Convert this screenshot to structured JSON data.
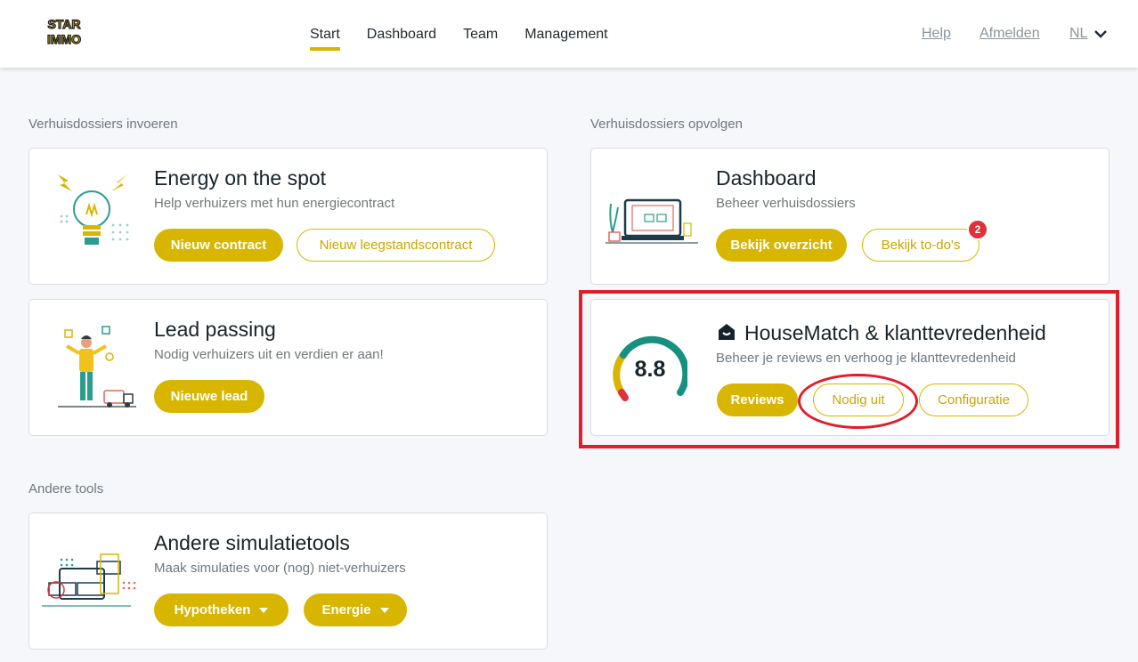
{
  "header": {
    "logo_text_top": "STAR",
    "logo_text_bottom": "IMMO",
    "nav": [
      {
        "label": "Start",
        "active": true
      },
      {
        "label": "Dashboard",
        "active": false
      },
      {
        "label": "Team",
        "active": false
      },
      {
        "label": "Management",
        "active": false
      }
    ],
    "help_label": "Help",
    "logout_label": "Afmelden",
    "language": "NL"
  },
  "sections": {
    "left_title": "Verhuisdossiers invoeren",
    "right_title": "Verhuisdossiers opvolgen",
    "other_title": "Andere tools"
  },
  "cards": {
    "energy": {
      "title": "Energy on the spot",
      "subtitle": "Help verhuizers met hun energiecontract",
      "buttons": [
        "Nieuw contract",
        "Nieuw leegstandscontract"
      ]
    },
    "lead": {
      "title": "Lead passing",
      "subtitle": "Nodig verhuizers uit en verdien er aan!",
      "buttons": [
        "Nieuwe lead"
      ]
    },
    "dashboard": {
      "title": "Dashboard",
      "subtitle": "Beheer verhuisdossiers",
      "buttons": [
        "Bekijk overzicht",
        "Bekijk to-do's"
      ],
      "todo_count": "2"
    },
    "housematch": {
      "title": "HouseMatch & klanttevredenheid",
      "subtitle": "Beheer je reviews en verhoog je klanttevredenheid",
      "score": "8.8",
      "buttons": [
        "Reviews",
        "Nodig uit",
        "Configuratie"
      ]
    },
    "simulation": {
      "title": "Andere simulatietools",
      "subtitle": "Maak simulaties voor (nog) niet-verhuizers",
      "buttons": [
        "Hypotheken",
        "Energie"
      ]
    }
  },
  "colors": {
    "accent": "#d8b600",
    "badge": "#e0313a",
    "highlight": "#e11d2a",
    "gauge_green": "#17917f"
  }
}
